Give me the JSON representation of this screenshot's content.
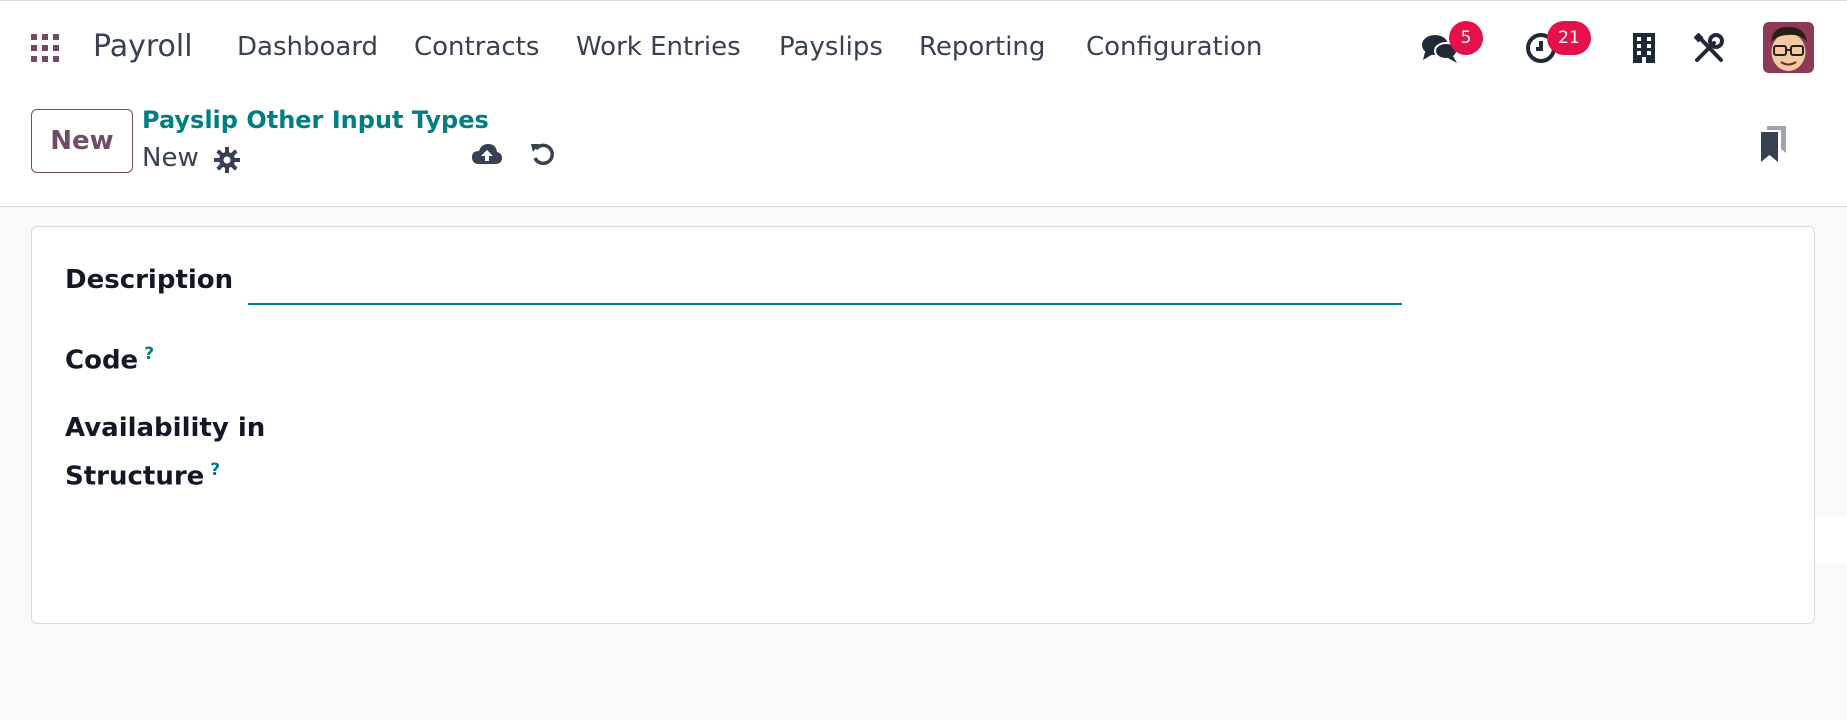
{
  "app": {
    "name": "Payroll"
  },
  "menu": [
    "Dashboard",
    "Contracts",
    "Work Entries",
    "Payslips",
    "Reporting",
    "Configuration"
  ],
  "systray": {
    "messages_count": "5",
    "activities_count": "21"
  },
  "control_panel": {
    "new_label": "New",
    "breadcrumb": "Payslip Other Input Types",
    "record_name": "New"
  },
  "form": {
    "description_label": "Description",
    "description_value": "",
    "code_label": "Code",
    "code_help": "?",
    "availability_label_line1": "Availability in",
    "availability_label_line2": "Structure",
    "availability_help": "?"
  },
  "colors": {
    "brand": "#714b67",
    "accent": "#017e84",
    "badge": "#e4114a"
  },
  "icons": {
    "apps": "apps-grid-icon",
    "messages": "chat-bubbles-icon",
    "activities": "clock-icon",
    "company": "building-icon",
    "debug": "tools-icon",
    "gear": "gear-icon",
    "save": "cloud-upload-icon",
    "discard": "undo-icon",
    "bookmark": "bookmark-icon"
  }
}
